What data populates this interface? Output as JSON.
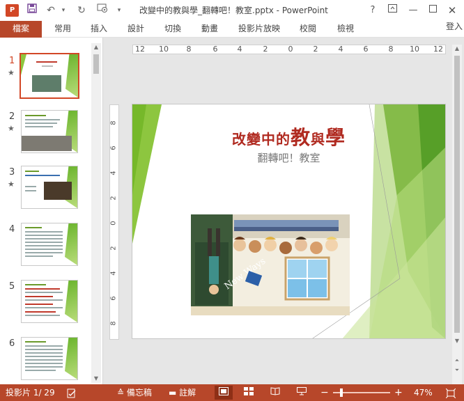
{
  "titlebar": {
    "app_icon_label": "P",
    "title": "改變中的教與學_翻轉吧！教室.pptx - PowerPoint",
    "help": "?",
    "icons": [
      "save-icon",
      "undo-icon",
      "redo-icon",
      "start-from-beginning-icon",
      "customize-qat-icon",
      "ribbon-display-icon",
      "minimize-icon",
      "maximize-icon",
      "close-icon"
    ]
  },
  "ribbon": {
    "tabs": [
      "檔案",
      "常用",
      "插入",
      "設計",
      "切換",
      "動畫",
      "投影片放映",
      "校閱",
      "檢視"
    ],
    "signin": "登入"
  },
  "rulers": {
    "horizontal": [
      "12",
      "10",
      "8",
      "6",
      "4",
      "2",
      "0",
      "2",
      "4",
      "6",
      "8",
      "10",
      "12"
    ],
    "vertical": [
      "8",
      "6",
      "4",
      "2",
      "0",
      "2",
      "4",
      "6",
      "8"
    ]
  },
  "thumbnails": [
    {
      "number": "1",
      "star": "★",
      "active": true
    },
    {
      "number": "2",
      "star": "★",
      "active": false
    },
    {
      "number": "3",
      "star": "★",
      "active": false
    },
    {
      "number": "4",
      "star": "",
      "active": false
    },
    {
      "number": "5",
      "star": "",
      "active": false
    },
    {
      "number": "6",
      "star": "",
      "active": false
    }
  ],
  "slide": {
    "title_pre": "改變中的",
    "title_big1": "教",
    "title_mid": "與",
    "title_big2": "學",
    "subtitle": "翻轉吧！教室",
    "image_text": "New Ways"
  },
  "statusbar": {
    "slide_counter": "投影片 1/ 29",
    "notes_label": "備忘稿",
    "comments_label": "註解",
    "zoom_minus": "−",
    "zoom_plus": "+",
    "zoom_level": "47%",
    "zoom_fraction": 0.47
  },
  "colors": {
    "accent": "#b7472a",
    "slide_green": "#8dc63f",
    "title_red": "#b02a20"
  }
}
